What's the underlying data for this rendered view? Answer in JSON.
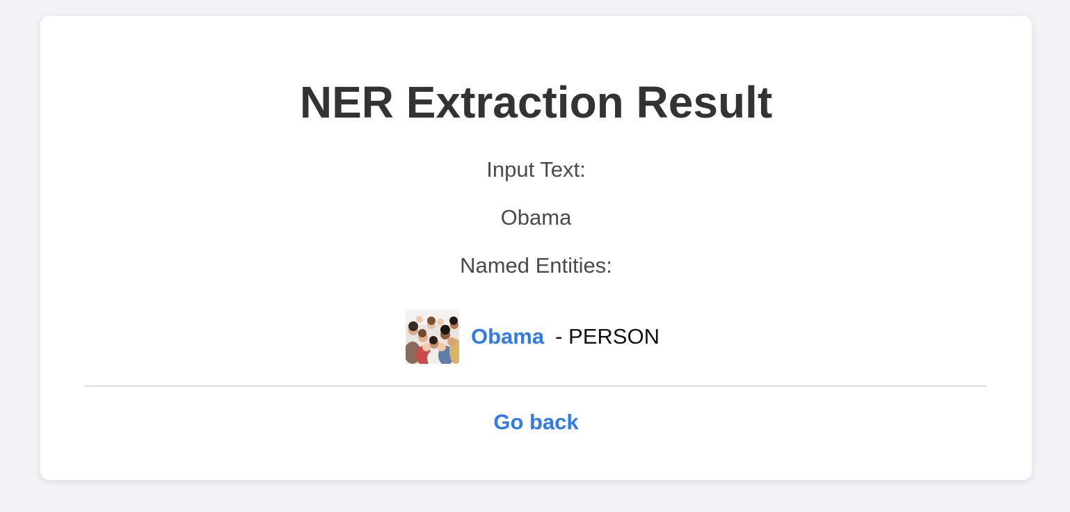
{
  "page": {
    "title": "NER Extraction Result",
    "input_label": "Input Text:",
    "input_value": "Obama",
    "entities_label": "Named Entities:"
  },
  "entities": [
    {
      "text": "Obama",
      "type_label": "- PERSON",
      "image": "group-photo-thumbnail"
    }
  ],
  "footer": {
    "back_label": "Go back"
  },
  "colors": {
    "background": "#f3f3f7",
    "card": "#ffffff",
    "title": "#333333",
    "body_text": "#4a4a4a",
    "link": "#2f7bea",
    "divider": "#dcdcdc"
  }
}
